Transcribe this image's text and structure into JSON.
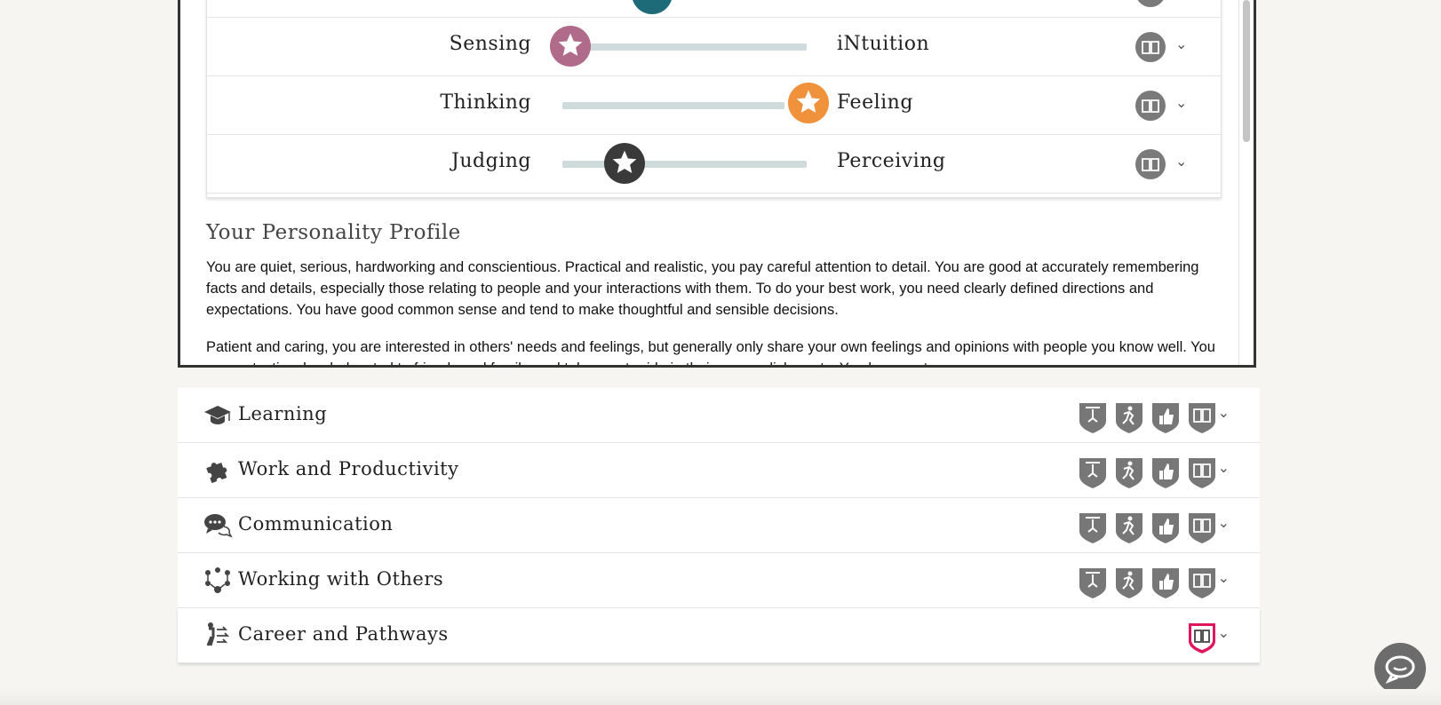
{
  "traits": {
    "rows": [
      {
        "left": "Sensing",
        "right": "iNtuition",
        "knob_color": "#b06a8a",
        "position": 0.02
      },
      {
        "left": "Thinking",
        "right": "Feeling",
        "knob_color": "#f0913c",
        "position": 0.98
      },
      {
        "left": "Judging",
        "right": "Perceiving",
        "knob_color": "#3a3a3a",
        "position": 0.22
      }
    ],
    "top_knob_color": "#1d6a78"
  },
  "profile": {
    "title": "Your Personality Profile",
    "paragraph1": "You are quiet, serious, hardworking and conscientious. Practical and realistic, you pay careful attention to detail. You are good at accurately remembering facts and details, especially those relating to people and your interactions with them. To do your best work, you need clearly defined directions and expectations. You have good common sense and tend to make thoughtful and sensible decisions.",
    "paragraph2": "Patient and caring, you are interested in others' needs and feelings, but generally only share your own feelings and opinions with people you know well. You are protective, loyal, devoted to friends and family, and take great pride in their accomplishments. You have a strong"
  },
  "categories": [
    {
      "label": "Learning",
      "icon": "graduation-cap-icon",
      "badges": [
        "weightlifter-badge-icon",
        "runner-badge-icon",
        "thumbs-up-badge-icon",
        "book-badge-icon"
      ]
    },
    {
      "label": "Work and Productivity",
      "icon": "puzzle-icon",
      "badges": [
        "weightlifter-badge-icon",
        "runner-badge-icon",
        "thumbs-up-badge-icon",
        "book-badge-icon"
      ]
    },
    {
      "label": "Communication",
      "icon": "speech-bubbles-icon",
      "badges": [
        "weightlifter-badge-icon",
        "runner-badge-icon",
        "thumbs-up-badge-icon",
        "book-badge-icon"
      ]
    },
    {
      "label": "Working with Others",
      "icon": "people-network-icon",
      "badges": [
        "weightlifter-badge-icon",
        "runner-badge-icon",
        "thumbs-up-badge-icon",
        "book-badge-icon"
      ]
    },
    {
      "label": "Career and Pathways",
      "icon": "career-path-icon",
      "badges": [
        "book-badge-icon"
      ]
    }
  ],
  "colors": {
    "badge_gray": "#777777",
    "badge_pink": "#e0175f",
    "track": "#cfdadd"
  }
}
